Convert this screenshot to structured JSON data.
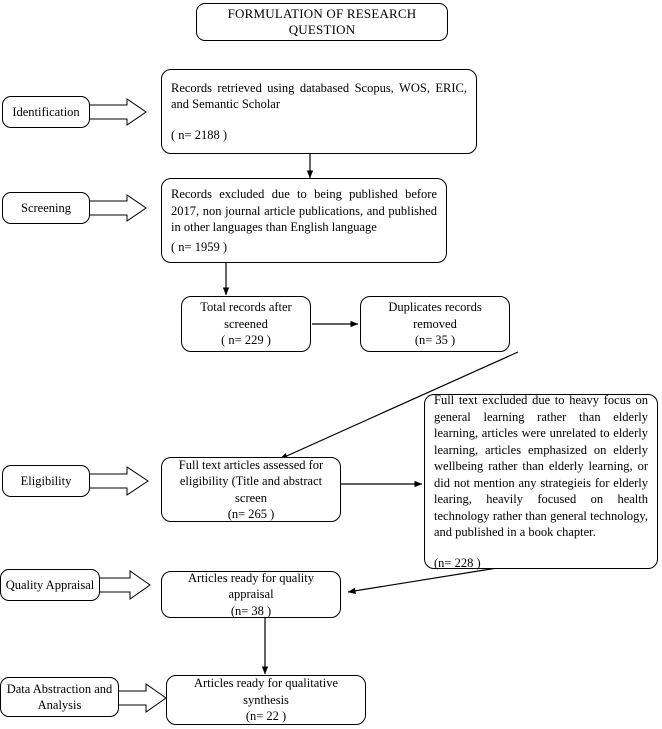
{
  "diagram": {
    "title": "FORMULATION OF RESEARCH QUESTION",
    "stage_labels": {
      "identification": "Identification",
      "screening": "Screening",
      "eligibility": "Eligibility",
      "quality_appraisal": "Quality Appraisal",
      "data_abstraction": "Data Abstraction and Analysis"
    },
    "nodes": {
      "records_retrieved": {
        "text": "Records retrieved using databased Scopus, WOS, ERIC, and Semantic Scholar",
        "count": "( n= 2188 )"
      },
      "records_excluded": {
        "text": "Records excluded due to being published before 2017, non journal article publications, and published in other languages than English language",
        "count": "( n= 1959 )"
      },
      "total_after_screened": {
        "line1": "Total records after",
        "line2": "screened",
        "count": "( n= 229 )"
      },
      "duplicates_removed": {
        "text": "Duplicates records removed",
        "count": "(n= 35 )"
      },
      "full_text_assessed": {
        "line1": "Full text articles assessed for",
        "line2": "eligibility (Title and abstract screen",
        "count": "(n= 265 )"
      },
      "full_text_excluded": {
        "text": "Full text excluded due to heavy focus on general learning rather than elderly learning, articles were unrelated to elderly learning, articles emphasized on elderly wellbeing rather than elderly learning, or did not mention any strategieis for elderly learing, heavily focused on health technology rather than general technology, and published in a book chapter.",
        "count": "(n= 228 )"
      },
      "ready_quality_appraisal": {
        "text": "Articles ready for quality appraisal",
        "count": "(n= 38 )"
      },
      "ready_qualitative_synthesis": {
        "text": "Articles ready for qualitative synthesis",
        "count": "(n= 22 )"
      }
    },
    "colors": {
      "stroke": "#000000",
      "fill": "#ffffff",
      "text": "#000000"
    }
  }
}
